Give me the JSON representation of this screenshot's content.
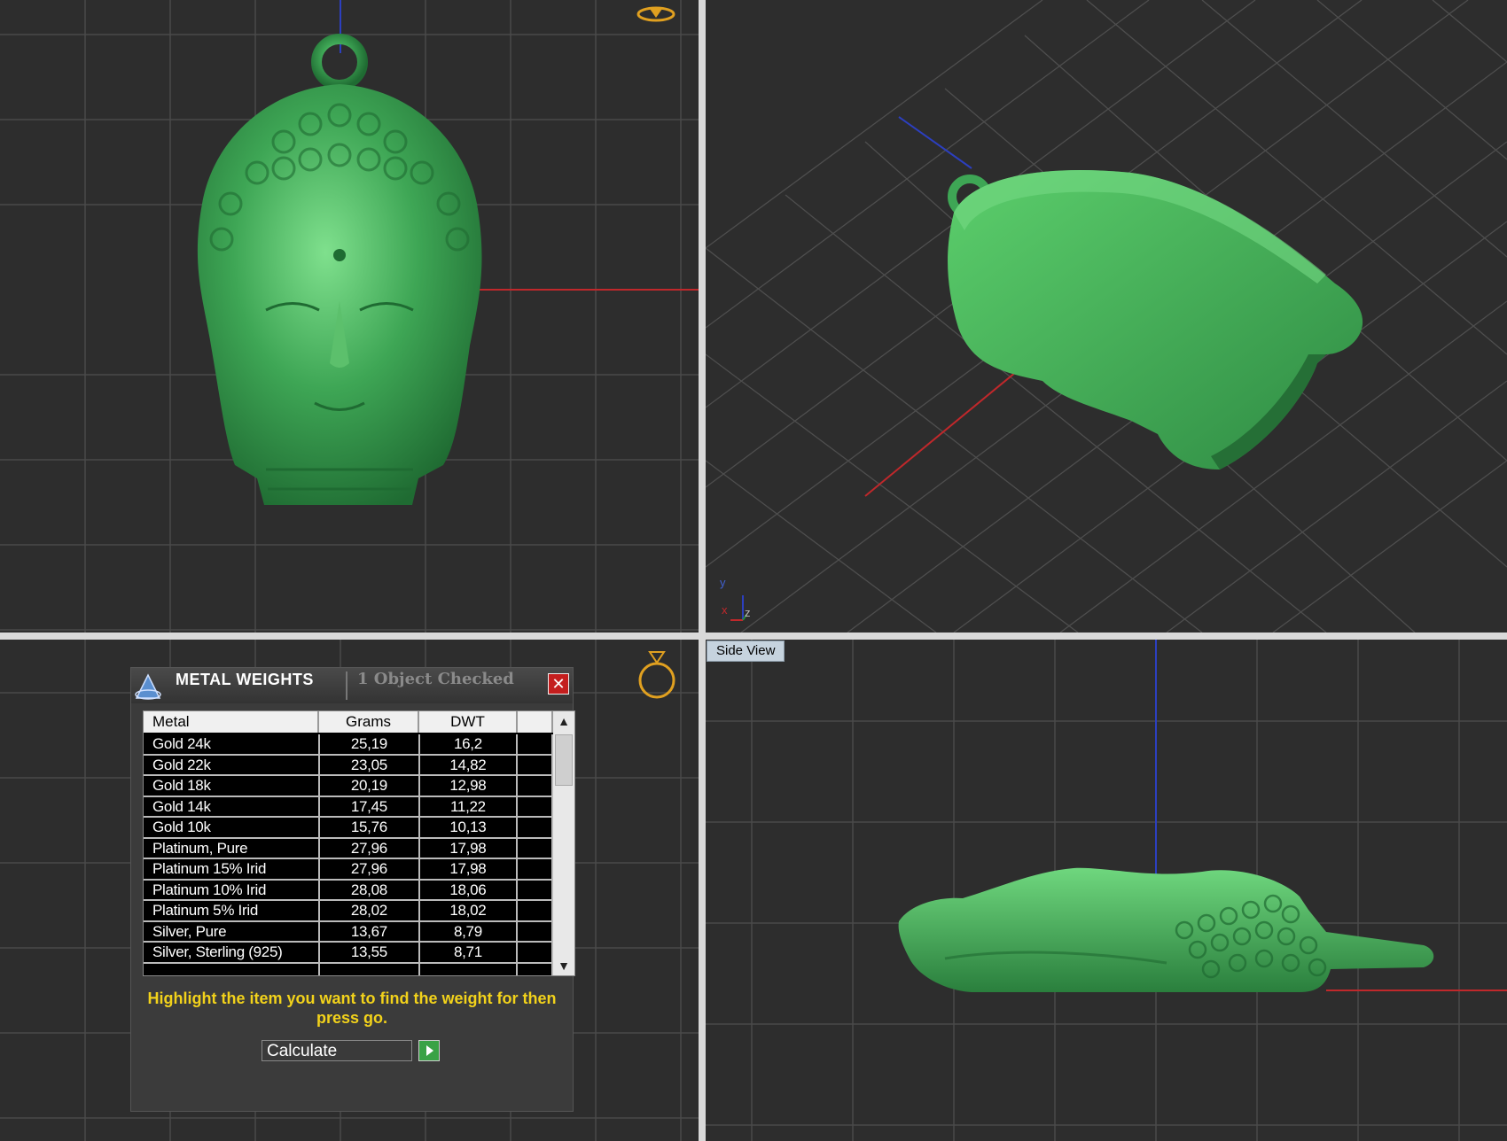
{
  "views": {
    "side_view_label": "Side View"
  },
  "axis_labels": {
    "y": "y",
    "x": "x",
    "z": "z"
  },
  "dialog": {
    "title": "METAL WEIGHTS",
    "status": "1 Object Checked",
    "close_icon": "close-icon",
    "columns": [
      "Metal",
      "Grams",
      "DWT"
    ],
    "rows": [
      {
        "metal": "Gold 24k",
        "grams": "25,19",
        "dwt": "16,2"
      },
      {
        "metal": "Gold 22k",
        "grams": "23,05",
        "dwt": "14,82"
      },
      {
        "metal": "Gold 18k",
        "grams": "20,19",
        "dwt": "12,98"
      },
      {
        "metal": "Gold 14k",
        "grams": "17,45",
        "dwt": "11,22"
      },
      {
        "metal": "Gold 10k",
        "grams": "15,76",
        "dwt": "10,13"
      },
      {
        "metal": "Platinum, Pure",
        "grams": "27,96",
        "dwt": "17,98"
      },
      {
        "metal": "Platinum 15% Irid",
        "grams": "27,96",
        "dwt": "17,98"
      },
      {
        "metal": "Platinum 10% Irid",
        "grams": "28,08",
        "dwt": "18,06"
      },
      {
        "metal": "Platinum 5% Irid",
        "grams": "28,02",
        "dwt": "18,02"
      },
      {
        "metal": "Silver, Pure",
        "grams": "13,67",
        "dwt": "8,79"
      },
      {
        "metal": "Silver, Sterling (925)",
        "grams": "13,55",
        "dwt": "8,71"
      },
      {
        "metal": "",
        "grams": "",
        "dwt": ""
      }
    ],
    "instruction": "Highlight the item you want to find the weight for then press go.",
    "calc_value": "Calculate"
  },
  "colors": {
    "model_green": "#3ea655",
    "viewport_bg": "#2d2d2d",
    "grid": "#4a4a4a",
    "axis_red": "#c0282b",
    "axis_blue": "#2c3fbf",
    "accent_yellow": "#f2d21b",
    "ring_icon": "#e0a020"
  }
}
